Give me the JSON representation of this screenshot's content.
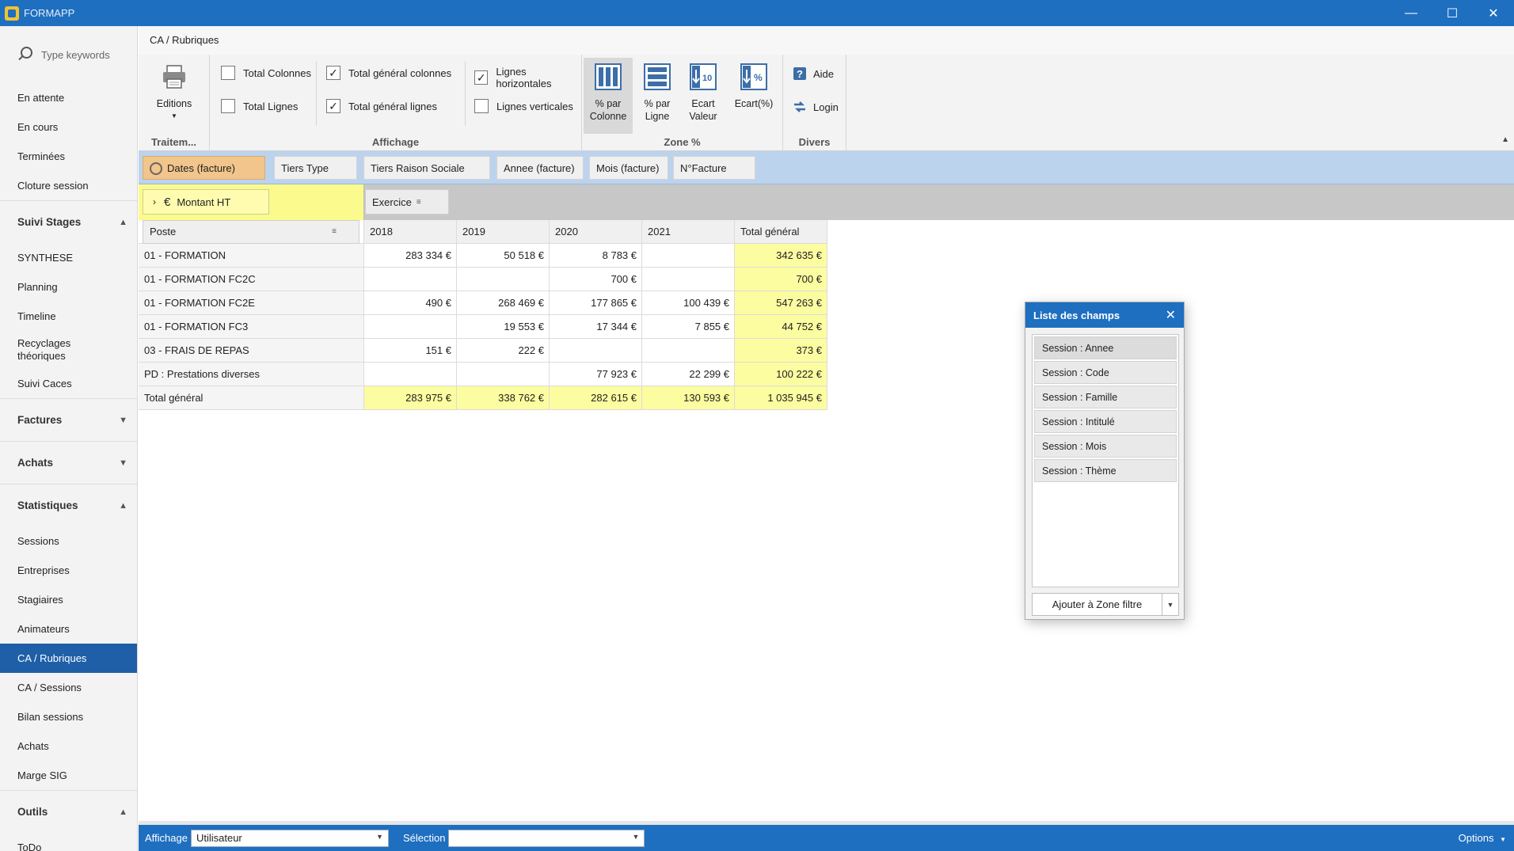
{
  "app": {
    "title": "FORMAPP"
  },
  "sidebar": {
    "search_placeholder": "Type keywords",
    "top_items": [
      "En attente",
      "En cours",
      "Terminées",
      "Cloture session"
    ],
    "sections": [
      {
        "title": "Suivi Stages",
        "expanded": true,
        "items": [
          "SYNTHESE",
          "Planning",
          "Timeline",
          "Recyclages théoriques",
          "Suivi Caces"
        ]
      },
      {
        "title": "Factures",
        "expanded": false,
        "items": []
      },
      {
        "title": "Achats",
        "expanded": false,
        "items": []
      },
      {
        "title": "Statistiques",
        "expanded": true,
        "items": [
          "Sessions",
          "Entreprises",
          "Stagiaires",
          "Animateurs",
          "CA / Rubriques",
          "CA / Sessions",
          "Bilan sessions",
          "Achats",
          "Marge SIG"
        ]
      },
      {
        "title": "Outils",
        "expanded": true,
        "items": [
          "ToDo"
        ]
      }
    ],
    "active_item": "CA / Rubriques"
  },
  "breadcrumb": "CA / Rubriques",
  "ribbon": {
    "groups": {
      "traitement": "Traitem...",
      "affichage": "Affichage",
      "zone_pct": "Zone %",
      "divers": "Divers"
    },
    "editions_label": "Editions",
    "checkboxes": {
      "total_colonnes": {
        "label": "Total Colonnes",
        "checked": false
      },
      "total_lignes": {
        "label": "Total Lignes",
        "checked": false
      },
      "total_general_colonnes": {
        "label": "Total général colonnes",
        "checked": true
      },
      "total_general_lignes": {
        "label": "Total général lignes",
        "checked": true
      },
      "lignes_horizontales": {
        "label": "Lignes horizontales",
        "checked": true
      },
      "lignes_verticales": {
        "label": "Lignes verticales",
        "checked": false
      }
    },
    "zone_buttons": {
      "pct_colonne": "% par Colonne",
      "pct_ligne": "% par Ligne",
      "ecart_valeur": "Ecart Valeur",
      "ecart_pct": "Ecart(%)"
    },
    "divers": {
      "aide": "Aide",
      "login": "Login"
    }
  },
  "filter_zone": [
    "Dates (facture)",
    "Tiers Type",
    "Tiers Raison Sociale",
    "Annee (facture)",
    "Mois (facture)",
    "N°Facture"
  ],
  "data_zone": {
    "measure": "Montant HT",
    "column_field": "Exercice"
  },
  "pivot": {
    "row_header": "Poste",
    "columns": [
      "2018",
      "2019",
      "2020",
      "2021",
      "Total général"
    ],
    "rows": [
      {
        "label": "01 - FORMATION",
        "values": [
          "283 334 €",
          "50 518 €",
          "8 783 €",
          "",
          "342 635 €"
        ]
      },
      {
        "label": "01 - FORMATION FC2C",
        "values": [
          "",
          "",
          "700 €",
          "",
          "700 €"
        ]
      },
      {
        "label": "01 - FORMATION FC2E",
        "values": [
          "490 €",
          "268 469 €",
          "177 865 €",
          "100 439 €",
          "547 263 €"
        ]
      },
      {
        "label": "01 - FORMATION FC3",
        "values": [
          "",
          "19 553 €",
          "17 344 €",
          "7 855 €",
          "44 752 €"
        ]
      },
      {
        "label": "03 - FRAIS DE REPAS",
        "values": [
          "151 €",
          "222 €",
          "",
          "",
          "373 €"
        ]
      },
      {
        "label": "PD : Prestations diverses",
        "values": [
          "",
          "",
          "77 923 €",
          "22 299 €",
          "100 222 €"
        ]
      }
    ],
    "total_row": {
      "label": "Total général",
      "values": [
        "283 975 €",
        "338 762 €",
        "282 615 €",
        "130 593 €",
        "1 035 945 €"
      ]
    }
  },
  "field_list": {
    "title": "Liste des champs",
    "items": [
      "Session : Annee",
      "Session : Code",
      "Session : Famille",
      "Session : Intitulé",
      "Session : Mois",
      "Session : Thème"
    ],
    "add_button": "Ajouter à Zone filtre"
  },
  "statusbar": {
    "affichage_label": "Affichage",
    "affichage_value": "Utilisateur",
    "selection_label": "Sélection",
    "selection_value": "",
    "options_label": "Options"
  },
  "colors": {
    "accent": "#1e6fc0",
    "active_nav": "#1e5fa8",
    "filter_zone": "#bcd3ee",
    "total_cell": "#fcfca0",
    "active_chip": "#f1c58b"
  }
}
